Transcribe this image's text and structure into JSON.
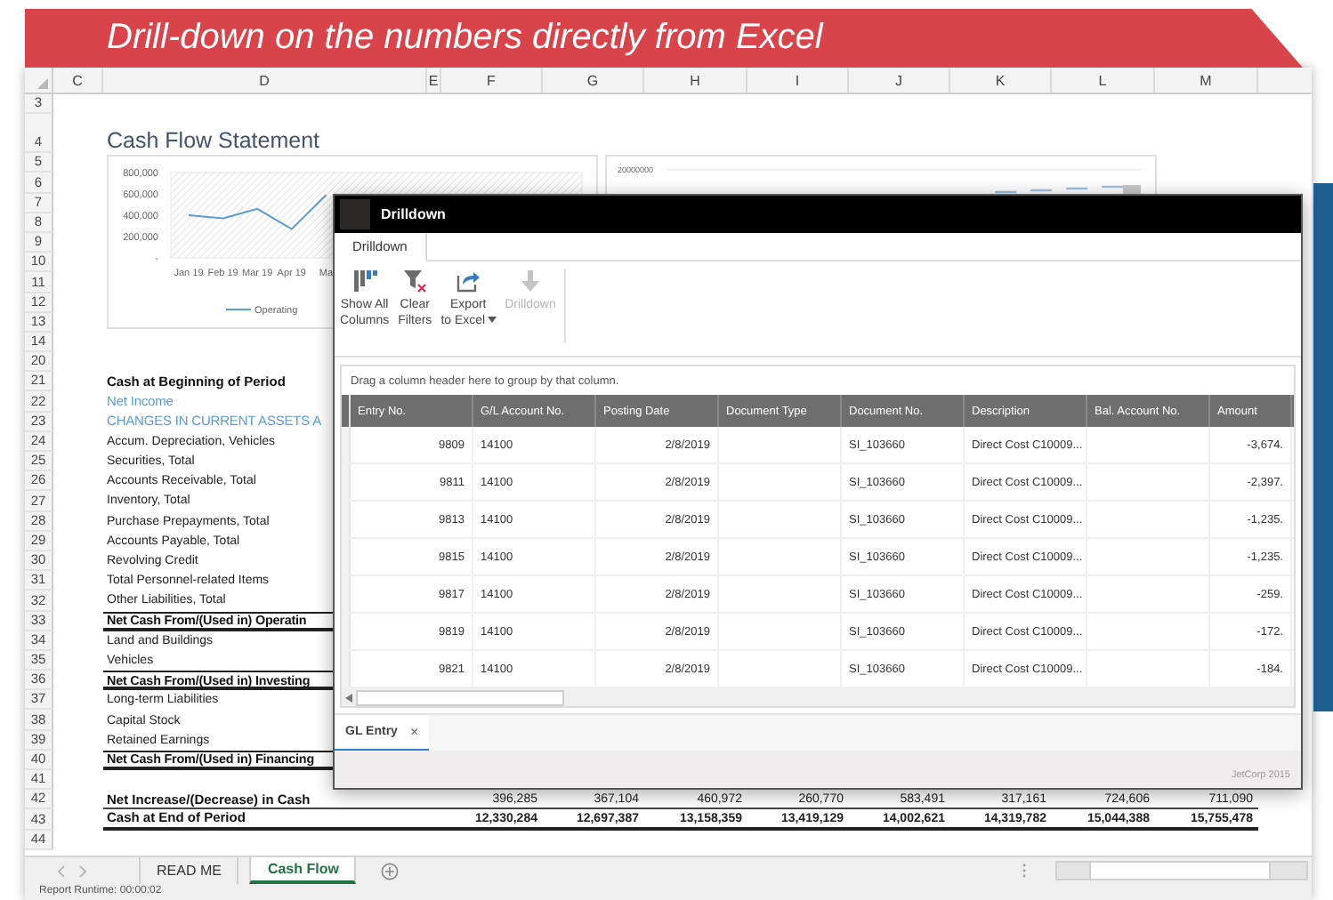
{
  "banner": {
    "text": "Drill-down on the numbers directly from Excel"
  },
  "sheet": {
    "columns": [
      "C",
      "D",
      "E",
      "F",
      "G",
      "H",
      "I",
      "J",
      "K",
      "L",
      "M"
    ],
    "rows": [
      {
        "number": "3"
      },
      {
        "number": "4",
        "kind": "title",
        "label": "Cash Flow Statement"
      },
      {
        "number": "5"
      },
      {
        "number": "6"
      },
      {
        "number": "7"
      },
      {
        "number": "8"
      },
      {
        "number": "9"
      },
      {
        "number": "10"
      },
      {
        "number": "11"
      },
      {
        "number": "12"
      },
      {
        "number": "13"
      },
      {
        "number": "14"
      },
      {
        "number": "20"
      },
      {
        "number": "21",
        "kind": "heading",
        "label": "Cash at Beginning of Period"
      },
      {
        "number": "22",
        "kind": "accent",
        "label": "Net Income"
      },
      {
        "number": "23",
        "kind": "accent",
        "label": "CHANGES IN CURRENT ASSETS A"
      },
      {
        "number": "24",
        "kind": "item",
        "label": "Accum. Depreciation, Vehicles"
      },
      {
        "number": "25",
        "kind": "item",
        "label": "Securities, Total"
      },
      {
        "number": "26",
        "kind": "item",
        "label": "Accounts Receivable, Total"
      },
      {
        "number": "27",
        "kind": "item",
        "label": "Inventory, Total"
      },
      {
        "number": "28",
        "kind": "item",
        "label": "Purchase Prepayments, Total"
      },
      {
        "number": "29",
        "kind": "item",
        "label": "Accounts Payable, Total"
      },
      {
        "number": "30",
        "kind": "item",
        "label": "Revolving Credit"
      },
      {
        "number": "31",
        "kind": "item",
        "label": "Total Personnel-related Items"
      },
      {
        "number": "32",
        "kind": "item",
        "label": "Other Liabilities, Total"
      },
      {
        "number": "33",
        "kind": "total",
        "label": "Net Cash From/(Used in) Operatin"
      },
      {
        "number": "34",
        "kind": "item",
        "label": "Land and Buildings"
      },
      {
        "number": "35",
        "kind": "item",
        "label": "Vehicles"
      },
      {
        "number": "36",
        "kind": "total",
        "label": "Net Cash From/(Used in) Investing"
      },
      {
        "number": "37",
        "kind": "item",
        "label": "Long-term Liabilities"
      },
      {
        "number": "38",
        "kind": "item",
        "label": "Capital Stock"
      },
      {
        "number": "39",
        "kind": "item",
        "label": "Retained Earnings"
      },
      {
        "number": "40",
        "kind": "total",
        "label": "Net Cash From/(Used in) Financing"
      },
      {
        "number": "41"
      },
      {
        "number": "42",
        "kind": "summary",
        "label": "Net Increase/(Decrease) in Cash",
        "values": [
          "396,285",
          "367,104",
          "460,972",
          "260,770",
          "583,491",
          "317,161",
          "724,606",
          "711,090"
        ]
      },
      {
        "number": "43",
        "kind": "grand-total",
        "label": "Cash at End of Period",
        "values": [
          "12,330,284",
          "12,697,387",
          "13,158,359",
          "13,419,129",
          "14,002,621",
          "14,319,782",
          "15,044,388",
          "15,755,478"
        ]
      },
      {
        "number": "44"
      }
    ]
  },
  "line_chart": {
    "chart_data": {
      "type": "line",
      "ylim": [
        0,
        800000
      ],
      "categories": [
        "Jan 19",
        "Feb 19",
        "Mar 19",
        "Apr 19",
        "Ma"
      ],
      "series": [
        {
          "name": "Operating",
          "color": "#5b9bd5",
          "values": [
            400000,
            370000,
            460000,
            270000,
            590000
          ]
        }
      ],
      "yticks": [
        {
          "value": 0,
          "label": "-"
        },
        {
          "value": 200000,
          "label": "200,000"
        },
        {
          "value": 400000,
          "label": "400,000"
        },
        {
          "value": 600000,
          "label": "600,000"
        },
        {
          "value": 800000,
          "label": "800,000"
        }
      ]
    }
  },
  "bar_chart": {
    "axis_label": "20000000"
  },
  "drilldown": {
    "title": "Drilldown",
    "ribbon_tabs": [
      {
        "label": "Drilldown",
        "selected": true
      }
    ],
    "toolbar": [
      {
        "kind": "show-columns",
        "label": "Show All\nColumns",
        "disabled": false
      },
      {
        "kind": "clear-filters",
        "label": "Clear\nFilters",
        "disabled": false
      },
      {
        "kind": "export",
        "label": "Export\nto Excel",
        "disabled": false
      },
      {
        "kind": "drilldown",
        "label": "Drilldown",
        "disabled": true
      }
    ],
    "hint": "Drag a column header here to group by that column.",
    "columns": [
      "Entry No.",
      "G/L Account No.",
      "Posting Date",
      "Document Type",
      "Document No.",
      "Description",
      "Bal. Account No.",
      "Amount"
    ],
    "rows": [
      {
        "entry_no": "9809",
        "gl_account_no": "14100",
        "posting_date": "2/8/2019",
        "document_no": "SI_103660",
        "description": "Direct Cost C10009...",
        "amount": "-3,674."
      },
      {
        "entry_no": "9811",
        "gl_account_no": "14100",
        "posting_date": "2/8/2019",
        "document_no": "SI_103660",
        "description": "Direct Cost C10009...",
        "amount": "-2,397."
      },
      {
        "entry_no": "9813",
        "gl_account_no": "14100",
        "posting_date": "2/8/2019",
        "document_no": "SI_103660",
        "description": "Direct Cost C10009...",
        "amount": "-1,235."
      },
      {
        "entry_no": "9815",
        "gl_account_no": "14100",
        "posting_date": "2/8/2019",
        "document_no": "SI_103660",
        "description": "Direct Cost C10009...",
        "amount": "-1,235."
      },
      {
        "entry_no": "9817",
        "gl_account_no": "14100",
        "posting_date": "2/8/2019",
        "document_no": "SI_103660",
        "description": "Direct Cost C10009...",
        "amount": "-259."
      },
      {
        "entry_no": "9819",
        "gl_account_no": "14100",
        "posting_date": "2/8/2019",
        "document_no": "SI_103660",
        "description": "Direct Cost C10009...",
        "amount": "-172."
      },
      {
        "entry_no": "9821",
        "gl_account_no": "14100",
        "posting_date": "2/8/2019",
        "document_no": "SI_103660",
        "description": "Direct Cost C10009...",
        "amount": "-184."
      }
    ],
    "tabs": [
      {
        "label": "GL Entry",
        "selected": true,
        "close": "×"
      }
    ],
    "footer": "JetCorp 2015"
  },
  "sheet_tabs": [
    {
      "label": "READ ME",
      "selected": false
    },
    {
      "label": "Cash Flow",
      "selected": true
    }
  ],
  "status_bar": "Report Runtime: 00:00:02"
}
